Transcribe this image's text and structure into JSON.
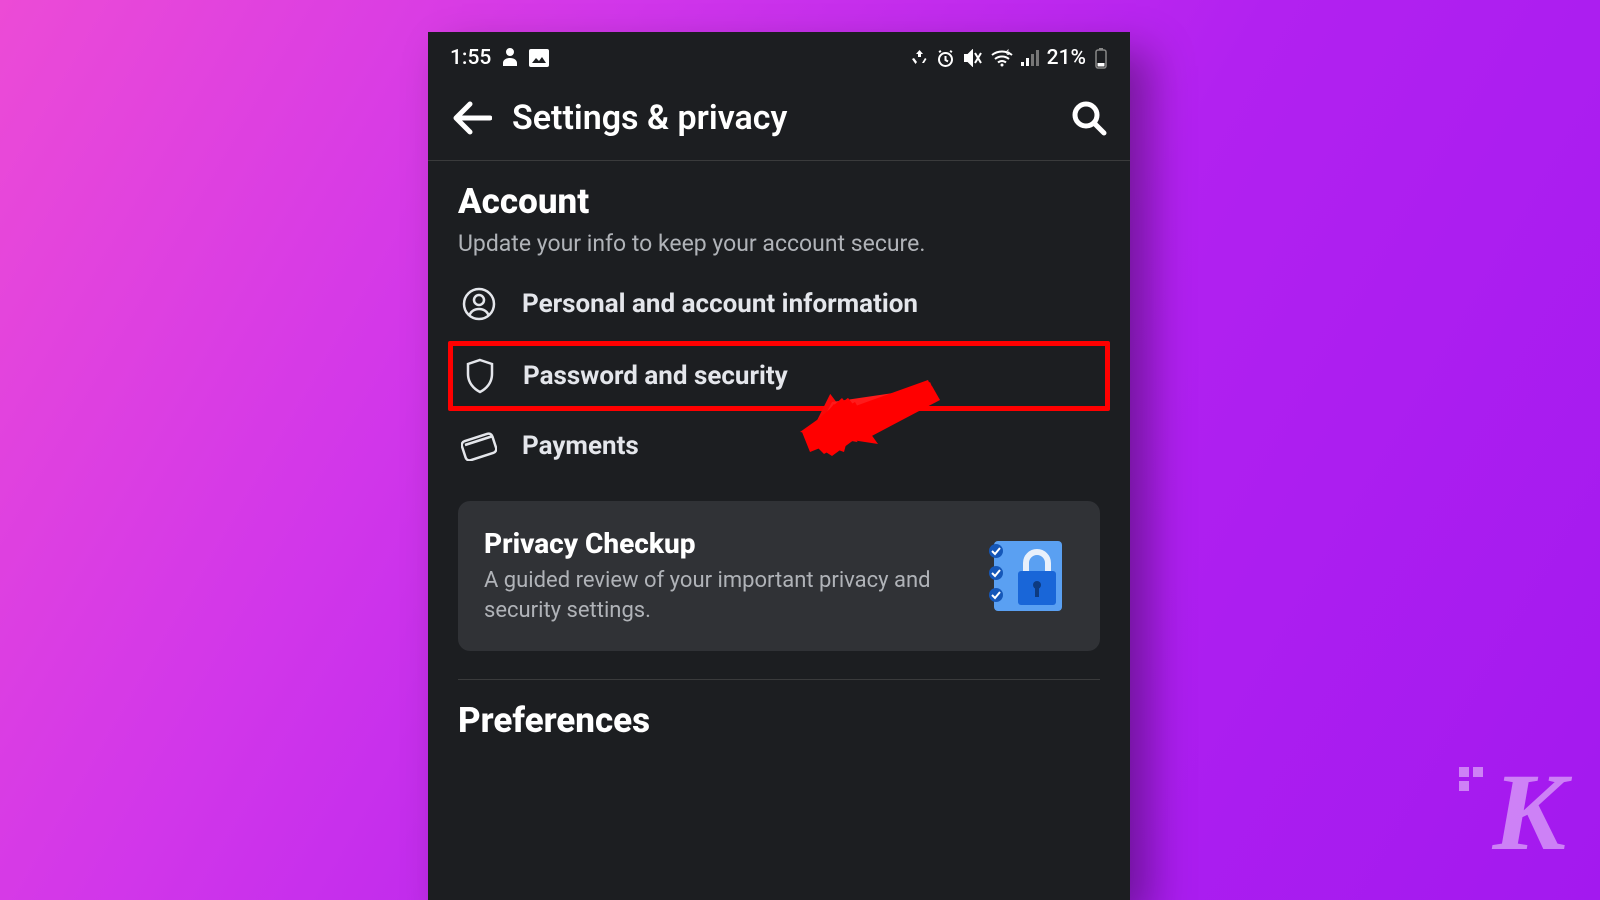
{
  "status": {
    "time": "1:55",
    "battery_pct": "21%"
  },
  "header": {
    "title": "Settings & privacy"
  },
  "account": {
    "title": "Account",
    "subtitle": "Update your info to keep your account secure.",
    "items": [
      {
        "label": "Personal and account information"
      },
      {
        "label": "Password and security"
      },
      {
        "label": "Payments"
      }
    ]
  },
  "privacy_card": {
    "title": "Privacy Checkup",
    "subtitle": "A guided review of your important privacy and security settings."
  },
  "preferences": {
    "title": "Preferences"
  },
  "watermark": "K"
}
